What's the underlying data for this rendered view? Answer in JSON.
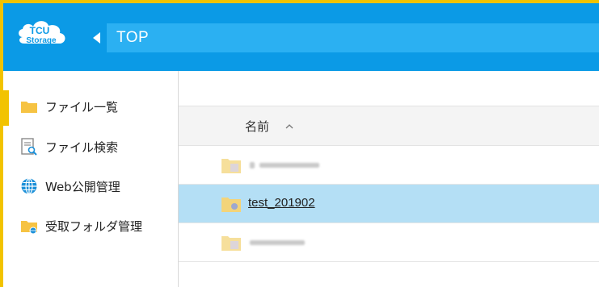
{
  "header": {
    "logo_text_top": "TCU",
    "logo_text_bottom": "Storage",
    "breadcrumb": "TOP"
  },
  "sidebar": {
    "items": [
      {
        "label": "ファイル一覧",
        "icon": "folder-icon",
        "active": true
      },
      {
        "label": "ファイル検索",
        "icon": "file-search-icon",
        "active": false
      },
      {
        "label": "Web公開管理",
        "icon": "globe-icon",
        "active": false
      },
      {
        "label": "受取フォルダ管理",
        "icon": "shared-folder-icon",
        "active": false
      }
    ]
  },
  "file_list": {
    "column_name": "名前",
    "sort_direction": "ascending",
    "rows": [
      {
        "name": "",
        "redacted": true,
        "selected": false
      },
      {
        "name": "test_201902",
        "redacted": false,
        "selected": true
      },
      {
        "name": "",
        "redacted": true,
        "selected": false
      }
    ]
  },
  "colors": {
    "header_blue": "#0b9ae6",
    "breadcrumb_blue": "#2bb0f2",
    "accent_yellow": "#f2c300",
    "selected_row": "#b4dff5",
    "folder_yellow": "#f6c343"
  }
}
